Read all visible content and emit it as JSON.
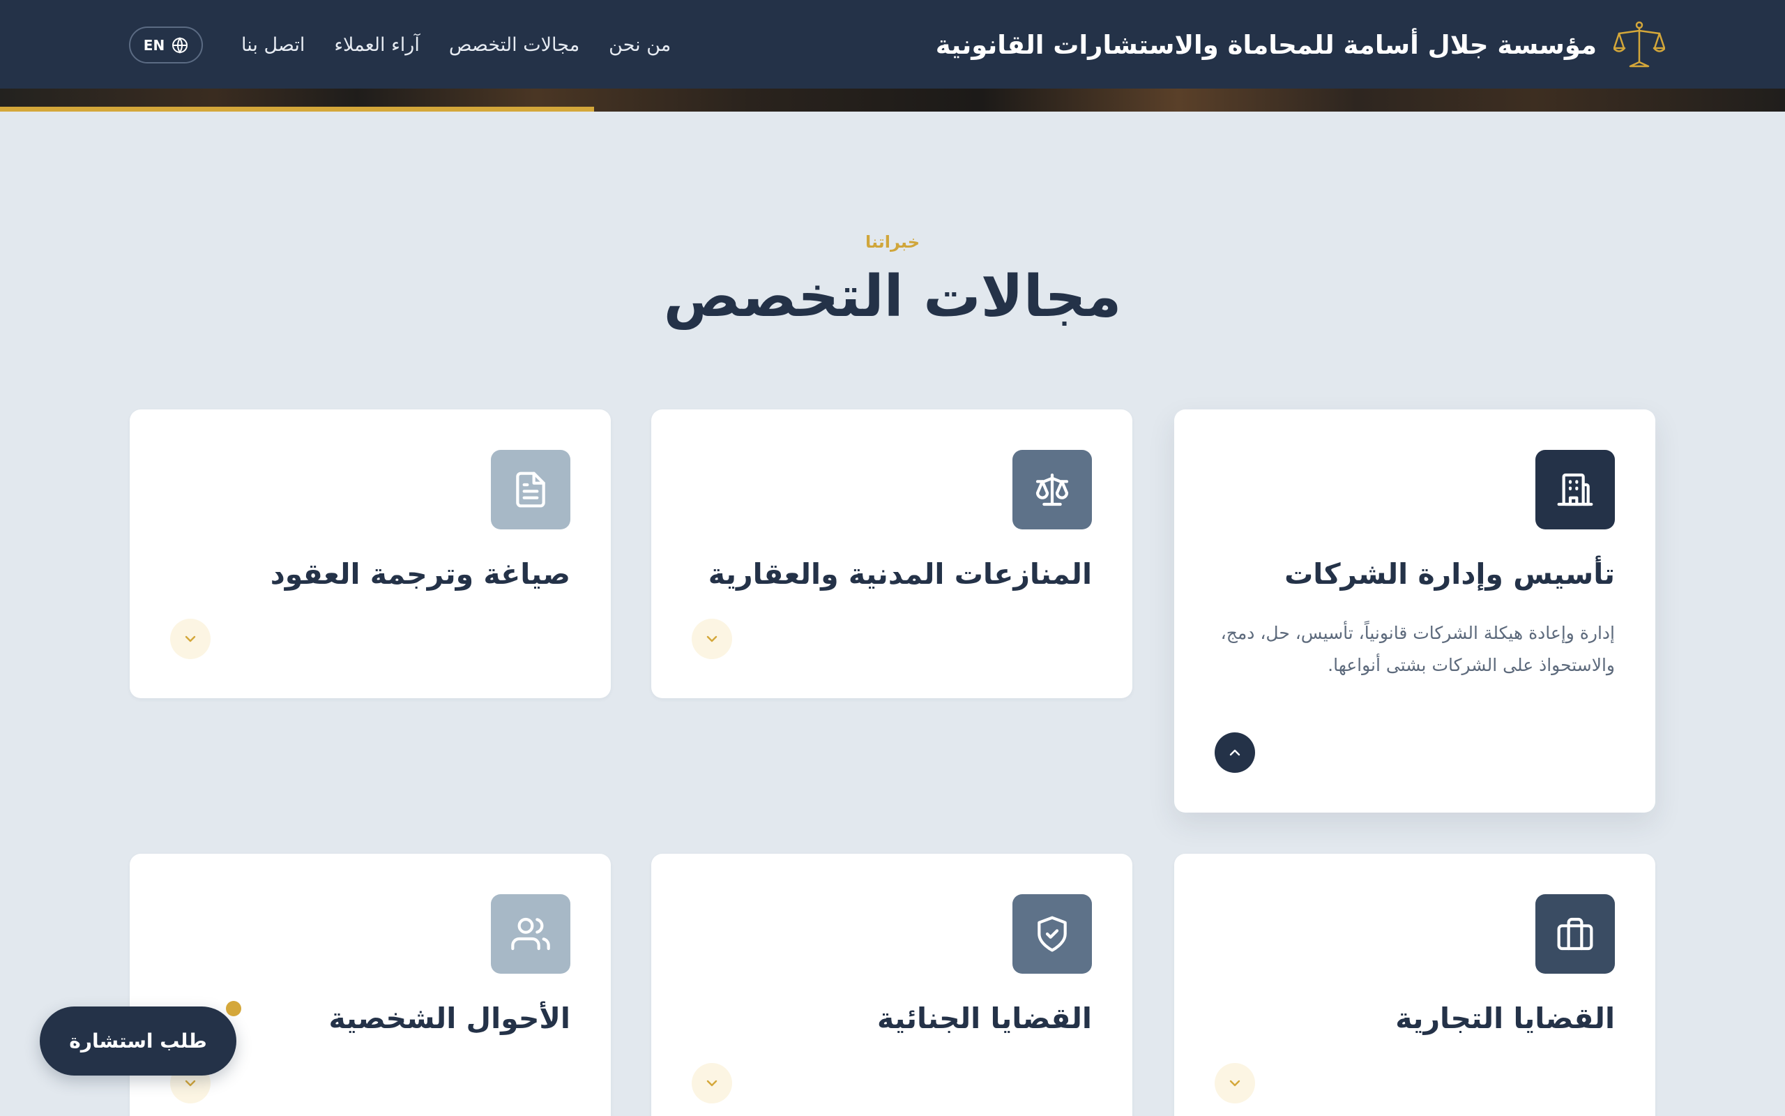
{
  "header": {
    "brand_name": "مؤسسة جلال أسامة للمحاماة والاستشارات القانونية",
    "nav": [
      {
        "label": "من نحن"
      },
      {
        "label": "مجالات التخصص"
      },
      {
        "label": "آراء العملاء"
      },
      {
        "label": "اتصل بنا"
      }
    ],
    "lang_label": "EN"
  },
  "hero": {
    "progress": 0.333
  },
  "section": {
    "eyebrow": "خبراتنا",
    "title": "مجالات التخصص"
  },
  "cards": [
    {
      "title": "تأسيس وإدارة الشركات",
      "description": "إدارة وإعادة هيكلة الشركات قانونياً، تأسيس، حل، دمج، والاستحواذ على الشركات بشتى أنواعها.",
      "icon": "building-icon",
      "expanded": true
    },
    {
      "title": "المنازعات المدنية والعقارية",
      "icon": "scale-icon",
      "expanded": false
    },
    {
      "title": "صياغة وترجمة العقود",
      "icon": "document-icon",
      "expanded": false
    },
    {
      "title": "القضايا التجارية",
      "icon": "briefcase-icon",
      "expanded": false
    },
    {
      "title": "القضايا الجنائية",
      "icon": "shield-check-icon",
      "expanded": false
    },
    {
      "title": "الأحوال الشخصية",
      "icon": "users-icon",
      "expanded": false
    }
  ],
  "colors": {
    "navy": "#243248",
    "slate": "#5e7289",
    "light_slate": "#a7b8c6",
    "gold": "#d4a73a",
    "background": "#e2e8ee"
  },
  "floating_button": {
    "label": "طلب استشارة"
  }
}
